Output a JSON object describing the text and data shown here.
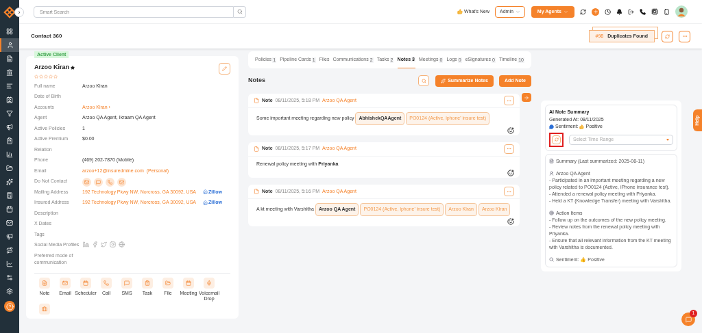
{
  "topbar": {
    "search_placeholder": "Smart Search",
    "whats_new": "What's New",
    "role": "Admin",
    "agents_button": "My Agents"
  },
  "collapse_toggle": "›",
  "page_header": {
    "title": "Contact 360",
    "duplicates_count": "#98",
    "duplicates_label": "Duplicates Found"
  },
  "sidebar": {
    "items": [
      {
        "selected": false
      },
      {
        "selected": true
      },
      {
        "selected": false
      },
      {
        "selected": false
      },
      {
        "selected": false
      },
      {
        "selected": false
      },
      {
        "selected": false
      },
      {
        "selected": false
      },
      {
        "selected": false
      },
      {
        "selected": false
      },
      {
        "selected": false
      },
      {
        "selected": false
      },
      {
        "selected": false
      },
      {
        "selected": false
      },
      {
        "selected": false
      },
      {
        "selected": false
      },
      {
        "selected": false
      },
      {
        "selected": false
      },
      {
        "selected": false
      },
      {
        "selected": false
      }
    ]
  },
  "contact": {
    "badge": "Active Client",
    "name": "Arzoo Kiran",
    "stars": 0,
    "fields": [
      {
        "label": "Full name",
        "value": "Arzoo Kiran",
        "kind": "text"
      },
      {
        "label": "Date of Birth",
        "kind": "text"
      },
      {
        "label": "Accounts",
        "value": "Arzoo Kiran ›",
        "kind": "link"
      },
      {
        "label": "Agent",
        "value": "Arzoo QA Agent, Ikraam QA Agent",
        "kind": "text"
      },
      {
        "label": "Active Policies",
        "value": "1",
        "kind": "text"
      },
      {
        "label": "Active Premium",
        "value": "$0.00",
        "kind": "text"
      },
      {
        "label": "Relation",
        "kind": "text"
      },
      {
        "label": "Phone",
        "value": "(469) 202-7870 (Mobile)",
        "kind": "text"
      },
      {
        "label": "Email",
        "value": "arzoo+12@insuredmine.com  (Personal)",
        "kind": "link"
      },
      {
        "label": "Do Not Contact",
        "kind": "contact-icons"
      },
      {
        "label": "Mailing Address",
        "value": "192 Technology Pkwy NW, Norcross, GA 30092, USA",
        "kind": "address",
        "extra": "Zillow"
      },
      {
        "label": "Insured Address",
        "value": "192 Technology Pkwy NW, Norcross, GA 30092, USA",
        "kind": "address",
        "extra": "Zillow"
      },
      {
        "label": "Description",
        "kind": "text"
      },
      {
        "label": "X Dates",
        "kind": "text"
      },
      {
        "label": "Tags",
        "kind": "text"
      },
      {
        "label": "Social Media Profiles",
        "kind": "social"
      },
      {
        "label": "Preferred mode of communication",
        "kind": "text"
      }
    ],
    "actions": [
      {
        "label": "Note"
      },
      {
        "label": "Email"
      },
      {
        "label": "Scheduler"
      },
      {
        "label": "Call"
      },
      {
        "label": "SMS"
      },
      {
        "label": "Task"
      },
      {
        "label": "File"
      },
      {
        "label": "Meeting"
      },
      {
        "label": "Voicemail Drop"
      },
      {
        "kind": "icon-only"
      }
    ]
  },
  "tabs": [
    {
      "label": "Policies",
      "count": "1",
      "selected": false
    },
    {
      "label": "Pipeline Cards",
      "count": "1",
      "selected": false
    },
    {
      "label": "Files",
      "selected": false
    },
    {
      "label": "Communications",
      "count": "2",
      "selected": false
    },
    {
      "label": "Tasks",
      "count": "2",
      "selected": false
    },
    {
      "label": "Notes",
      "count": "3",
      "selected": true
    },
    {
      "label": "Meetings",
      "count": "0",
      "selected": false
    },
    {
      "label": "Logs",
      "count": "0",
      "selected": false
    },
    {
      "label": "eSignatures",
      "count": "0",
      "selected": false
    },
    {
      "label": "Timeline",
      "count": "10",
      "selected": false
    }
  ],
  "notes": {
    "title": "Notes",
    "summarize_button": "Summarize Notes",
    "add_button": "Add Note",
    "items": [
      {
        "type": "Note",
        "time": "08/11/2025, 5:18 PM",
        "author": "Arzoo QA Agent",
        "text": "Some important meeting regarding new policy",
        "mentions": [
          {
            "label": "AbhishekQAAgent",
            "kind": "agent"
          },
          {
            "label": "PO0124 (Active,  iphone' insure test)",
            "kind": "policy"
          }
        ]
      },
      {
        "type": "Note",
        "time": "08/11/2025, 5:17 PM",
        "author": "Arzoo QA Agent",
        "text": "Renewal policy meeting with **Priyanka**"
      },
      {
        "type": "Note",
        "time": "08/11/2025, 5:16 PM",
        "author": "Arzoo QA Agent",
        "text": "A kt meeting with Varshitha",
        "mentions": [
          {
            "label": "Arzoo QA Agent",
            "kind": "agent"
          },
          {
            "label": "PO0124 (Active,  iphone' insure test)",
            "kind": "policy"
          },
          {
            "label": "Arzoo Kiran",
            "kind": "contact"
          },
          {
            "label": "Arzoo Kiran",
            "kind": "contact"
          }
        ]
      }
    ]
  },
  "ai_summary": {
    "title": "AI Note Summary",
    "generated": "Generated At: 08/11/2025",
    "sentiment_label": "Sentiment:",
    "sentiment_value": "Positive",
    "time_range_placeholder": "Select Time Range",
    "sections": [
      {
        "heading": "Summary (Last summarized: 2025-08-11)"
      },
      {
        "heading": "Arzoo QA Agent",
        "lines": [
          "- Participated in an important meeting regarding a new policy related to PO0124 (Active, iPhone insurance test).",
          "- Attended a renewal policy meeting with Priyanka.",
          "- Held a KT (Knowledge Transfer) meeting with Varshitha."
        ]
      },
      {
        "heading": "Action Items",
        "lines": [
          "- Follow up on the outcomes of the new policy meeting.",
          "- Review notes from the renewal policy meeting with Priyanka.",
          "- Ensure that all relevant information from the KT meeting with Varshitha is documented."
        ]
      },
      {
        "heading": "Sentiment: 👍 Positive"
      }
    ]
  },
  "help_tab": "Help",
  "chat_badge": "1"
}
